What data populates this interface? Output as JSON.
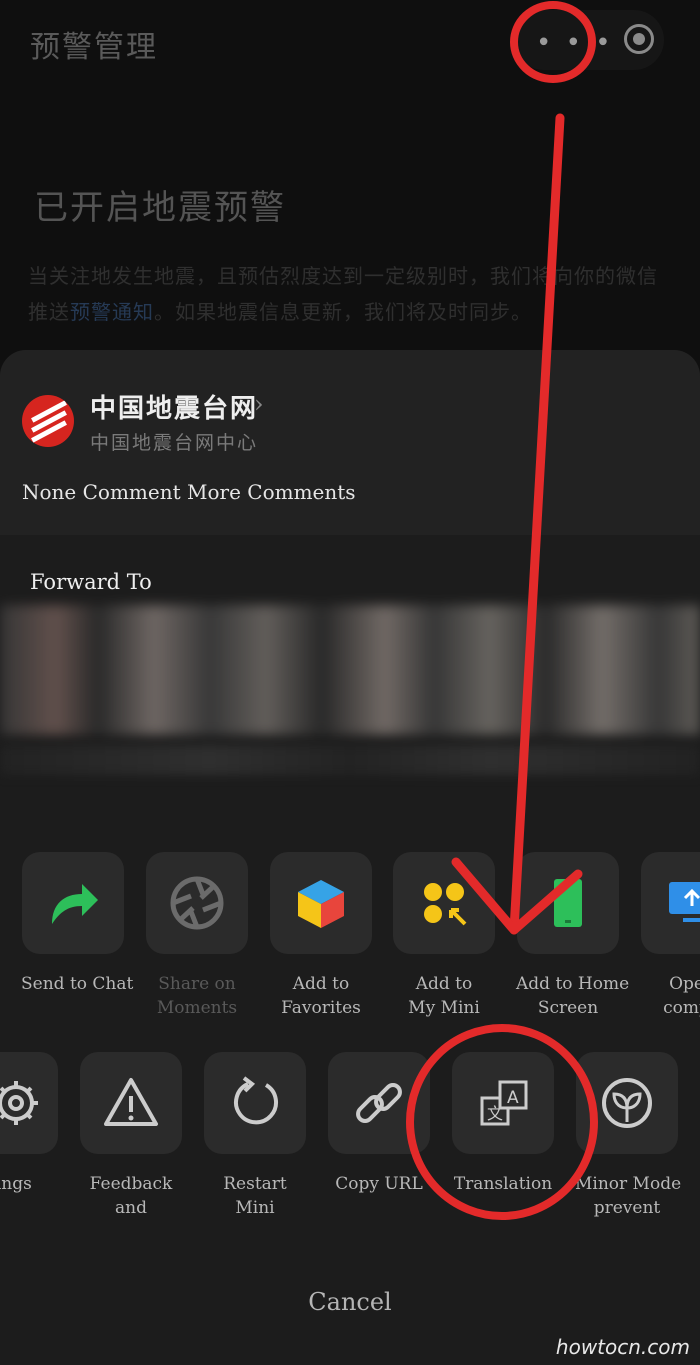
{
  "background_page": {
    "title": "预警管理",
    "heading": "已开启地震预警",
    "description_part1": "当关注地发生地震，且预估烈度达到一定级别时，我们将向你的微信推送",
    "description_link": "预警通知",
    "description_part2": "。如果地震信息更新，我们将及时同步。"
  },
  "capsule": {
    "more_icon": "more-dots-icon",
    "close_icon": "target-circle-icon"
  },
  "sheet": {
    "app_name": "中国地震台网",
    "app_subtitle": "中国地震台网中心",
    "comment_note": "None Comment  More Comments",
    "forward_label": "Forward To",
    "row1": [
      {
        "icon": "share-arrow-icon",
        "line1": "Send to Chat",
        "line2": "",
        "dim": false
      },
      {
        "icon": "aperture-icon",
        "line1": "Share on",
        "line2": "Moments",
        "dim": true
      },
      {
        "icon": "cube-icon",
        "line1": "Add to",
        "line2": "Favorites",
        "dim": false
      },
      {
        "icon": "mini-dots-icon",
        "line1": "Add to",
        "line2": "My Mini",
        "dim": false
      },
      {
        "icon": "phone-icon",
        "line1": "Add to Home",
        "line2": "Screen",
        "dim": false
      },
      {
        "icon": "monitor-icon",
        "line1": "Open",
        "line2": "compu",
        "dim": false
      }
    ],
    "row2": [
      {
        "icon": "gear-icon",
        "line1": "ttings",
        "line2": ""
      },
      {
        "icon": "warning-icon",
        "line1": "Feedback",
        "line2": "and"
      },
      {
        "icon": "restart-icon",
        "line1": "Restart",
        "line2": "Mini"
      },
      {
        "icon": "link-icon",
        "line1": "Copy URL",
        "line2": ""
      },
      {
        "icon": "translate-icon",
        "line1": "Translation",
        "line2": ""
      },
      {
        "icon": "sprout-icon",
        "line1": "Minor Mode",
        "line2": "prevent"
      }
    ],
    "cancel_label": "Cancel"
  },
  "watermark": "howtocn.com",
  "colors": {
    "annotation_red": "#e32a2a",
    "share_green": "#2dbf5a",
    "mini_yellow": "#f5c518",
    "monitor_blue": "#2f8fe8"
  }
}
